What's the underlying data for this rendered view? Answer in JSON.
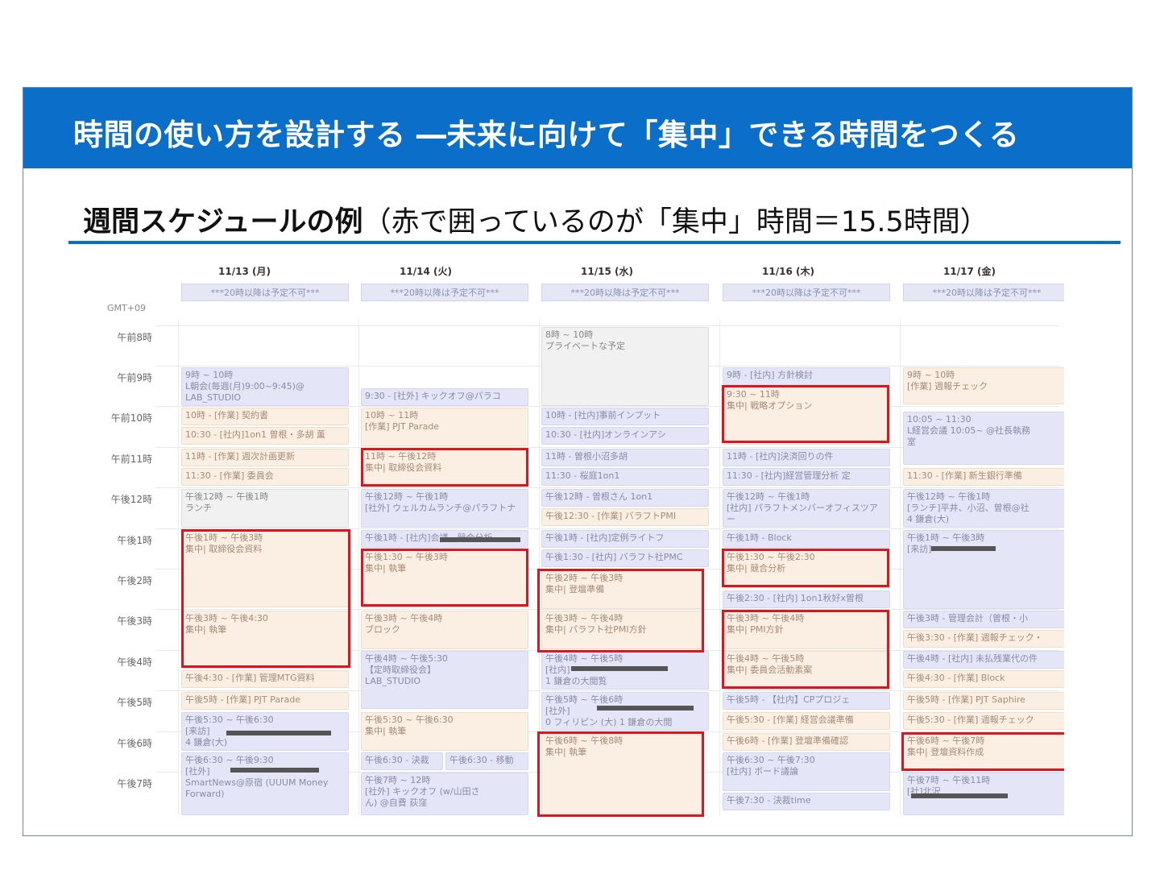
{
  "slide": {
    "title": "時間の使い方を設計する ―未来に向けて「集中」できる時間をつくる",
    "subtitle_strong": "週間スケジュールの例",
    "subtitle_rest": "（赤で囲っているのが「集中」時間＝15.5時間）"
  },
  "calendar": {
    "timezone": "GMT+09",
    "days": [
      "11/13 (月)",
      "11/14 (火)",
      "11/15 (水)",
      "11/16 (木)",
      "11/17 (金)"
    ],
    "allday_event": "***20時以降は予定不可***",
    "hours": [
      "午前8時",
      "午前9時",
      "午前10時",
      "午前11時",
      "午後12時",
      "午後1時",
      "午後2時",
      "午後3時",
      "午後4時",
      "午後5時",
      "午後6時",
      "午後7時"
    ],
    "events": {
      "mon": [
        "9時 ~ 10時\nL朝会(毎週(月)9:00~9:45)@\nLAB_STUDIO",
        "10時 - [作業] 契約書",
        "10:30 - [社内]1on1 曽根・多胡 薫",
        "11時 - [作業] 週次計画更新",
        "11:30 - [作業] 委員会",
        "午後12時 ~ 午後1時\nランチ",
        "午後1時 ~ 午後3時\n集中| 取締役会資料",
        "午後3時 ~ 午後4:30\n集中| 執筆",
        "午後4:30 - [作業] 管理MTG資料",
        "午後5時 - [作業] PJT Parade",
        "午後5:30 ~ 午後6:30\n[来訪]\n4 鎌倉(大)",
        "午後6:30 ~ 午後9:30\n[社外]\nSmartNews@原宿 (UUUM Money\nForward)"
      ],
      "tue": [
        "9:30 - [社外] キックオフ@パラコ",
        "10時 ~ 11時\n[作業] PJT Parade",
        "11時 ~ 午後12時\n集中| 取締役会資料",
        "午後12時 ~ 午後1時\n[社外] ウェルカムランチ@パラフトナ",
        "午後1時 - [社内]会議 - 競合分析",
        "午後1:30 ~ 午後3時\n集中| 執筆",
        "午後3時 ~ 午後4時\nブロック",
        "午後4時 ~ 午後5:30\n【定時取締役会】\nLAB_STUDIO",
        "午後5:30 ~ 午後6:30\n集中| 執筆",
        "午後6:30 - 決裁",
        "午後6:30 - 移動",
        "午後7時 ~ 12時\n[社外] キックオフ (w/山田さ\nん) @自費 荻窪"
      ],
      "wed": [
        "8時 ~ 10時\nプライベートな予定",
        "10時 - [社内]事前インプット",
        "10:30 - [社内]オンラインアシ",
        "11時 - 曽根小沼多胡",
        "11:30 - 桜庭1on1",
        "午後12時 - 曽根さん 1on1",
        "午後12:30 - [作業] バラフトPMI",
        "午後1時 - [社内]定例ライトフ",
        "午後1:30 - [社内] バラフト社PMC",
        "午後2時 ~ 午後3時\n集中| 登壇準備",
        "午後3時 ~ 午後4時\n集中| パラフト社PMI方針",
        "午後4時 ~ 午後5時\n[社内]\n1 鎌倉の大閲覧",
        "午後5時 ~ 午後6時\n[社外]\n0 フィリピン (大) 1 鎌倉の大閲",
        "午後6時 ~ 午後8時\n集中| 執筆"
      ],
      "thu": [
        "9時 - [社内] 方針検討",
        "9:30 ~ 11時\n集中| 戦略オプション",
        "11時 - [社内]決済回りの件",
        "11:30 - [社内]経営管理分析 定",
        "午後12時 ~ 午後1時\n[社内] パラフトメンバーオフィスツアー",
        "午後1時 - Block",
        "午後1:30 ~ 午後2:30\n集中| 競合分析",
        "午後2:30 - [社内] 1on1秋好x曽根",
        "午後3時 ~ 午後4時\n集中| PMI方針",
        "午後4時 ~ 午後5時\n集中| 委員会活動素案",
        "午後5時 - 【社内】CPプロジェ",
        "午後5:30 - [作業] 経営会議準備",
        "午後6時 - [作業] 登壇準備確認",
        "午後6:30 ~ 午後7:30\n[社内] ボード議論",
        "午後7:30 - 決裁time"
      ],
      "fri": [
        "9時 ~ 10時\n[作業] 週報チェック",
        "10:05 ~ 11:30\nL経営会議 10:05~ @社長執務\n室",
        "11:30 - [作業] 新生銀行準備",
        "午後12時 ~ 午後1時\n[ランチ]平井、小沼、曽根@社\n4 鎌倉(大)",
        "午後1時 ~ 午後3時\n[来訪]",
        "午後3時 - 管理会計（曽根・小",
        "午後3:30 - [作業] 週報チェック・",
        "午後4時 - [社内] 未払残業代の件",
        "午後4:30 - [作業] Block",
        "午後5時 - [作業] PJT Saphire",
        "午後5:30 - [作業] 週報チェック",
        "午後6時 ~ 午後7時\n集中| 登壇資料作成",
        "午後7時 ~ 午後11時\n[社]北沢"
      ]
    }
  },
  "colors": {
    "banner": "#0b6ec9",
    "focus_outline": "#e0141e",
    "event_blue": "#e4e6f8",
    "event_peach": "#fbeee2"
  }
}
